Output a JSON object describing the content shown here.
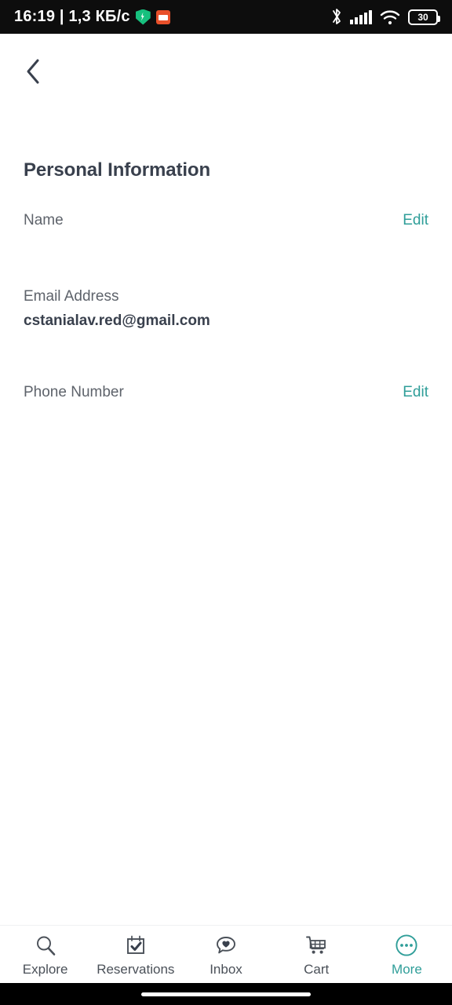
{
  "status_bar": {
    "clock": "16:19 | 1,3 КБ/с",
    "vpn_icon": "shield-icon",
    "notification_icon": "orange-app-icon",
    "bluetooth_icon": "bluetooth-icon",
    "signal_icon": "cellular-signal-icon",
    "wifi_icon": "wifi-icon",
    "battery_icon": "battery-icon",
    "battery_level": "30"
  },
  "header": {
    "back_icon": "chevron-left-icon",
    "title": "Personal Information"
  },
  "fields": [
    {
      "label": "Name",
      "value": "",
      "action": "Edit",
      "has_action": true
    },
    {
      "label": "Email Address",
      "value": "cstanialav.red@gmail.com",
      "action": "",
      "has_action": false
    },
    {
      "label": "Phone Number",
      "value": "",
      "action": "Edit",
      "has_action": true
    }
  ],
  "tabbar": {
    "items": [
      {
        "label": "Explore",
        "icon": "search-icon",
        "active": false
      },
      {
        "label": "Reservations",
        "icon": "calendar-check-icon",
        "active": false
      },
      {
        "label": "Inbox",
        "icon": "chat-heart-icon",
        "active": false
      },
      {
        "label": "Cart",
        "icon": "shopping-cart-icon",
        "active": false
      },
      {
        "label": "More",
        "icon": "ellipsis-circle-icon",
        "active": true
      }
    ]
  },
  "system_nav": {
    "home_indicator": "home-indicator"
  },
  "colors": {
    "accent_teal": "#2f9e99",
    "title_dark": "#39404d",
    "label_gray": "#5e636b",
    "status_bar_bg": "#0d0d0d",
    "page_bg": "#ffffff",
    "shield_green": "#17c07e",
    "notif_orange": "#e8502a"
  }
}
